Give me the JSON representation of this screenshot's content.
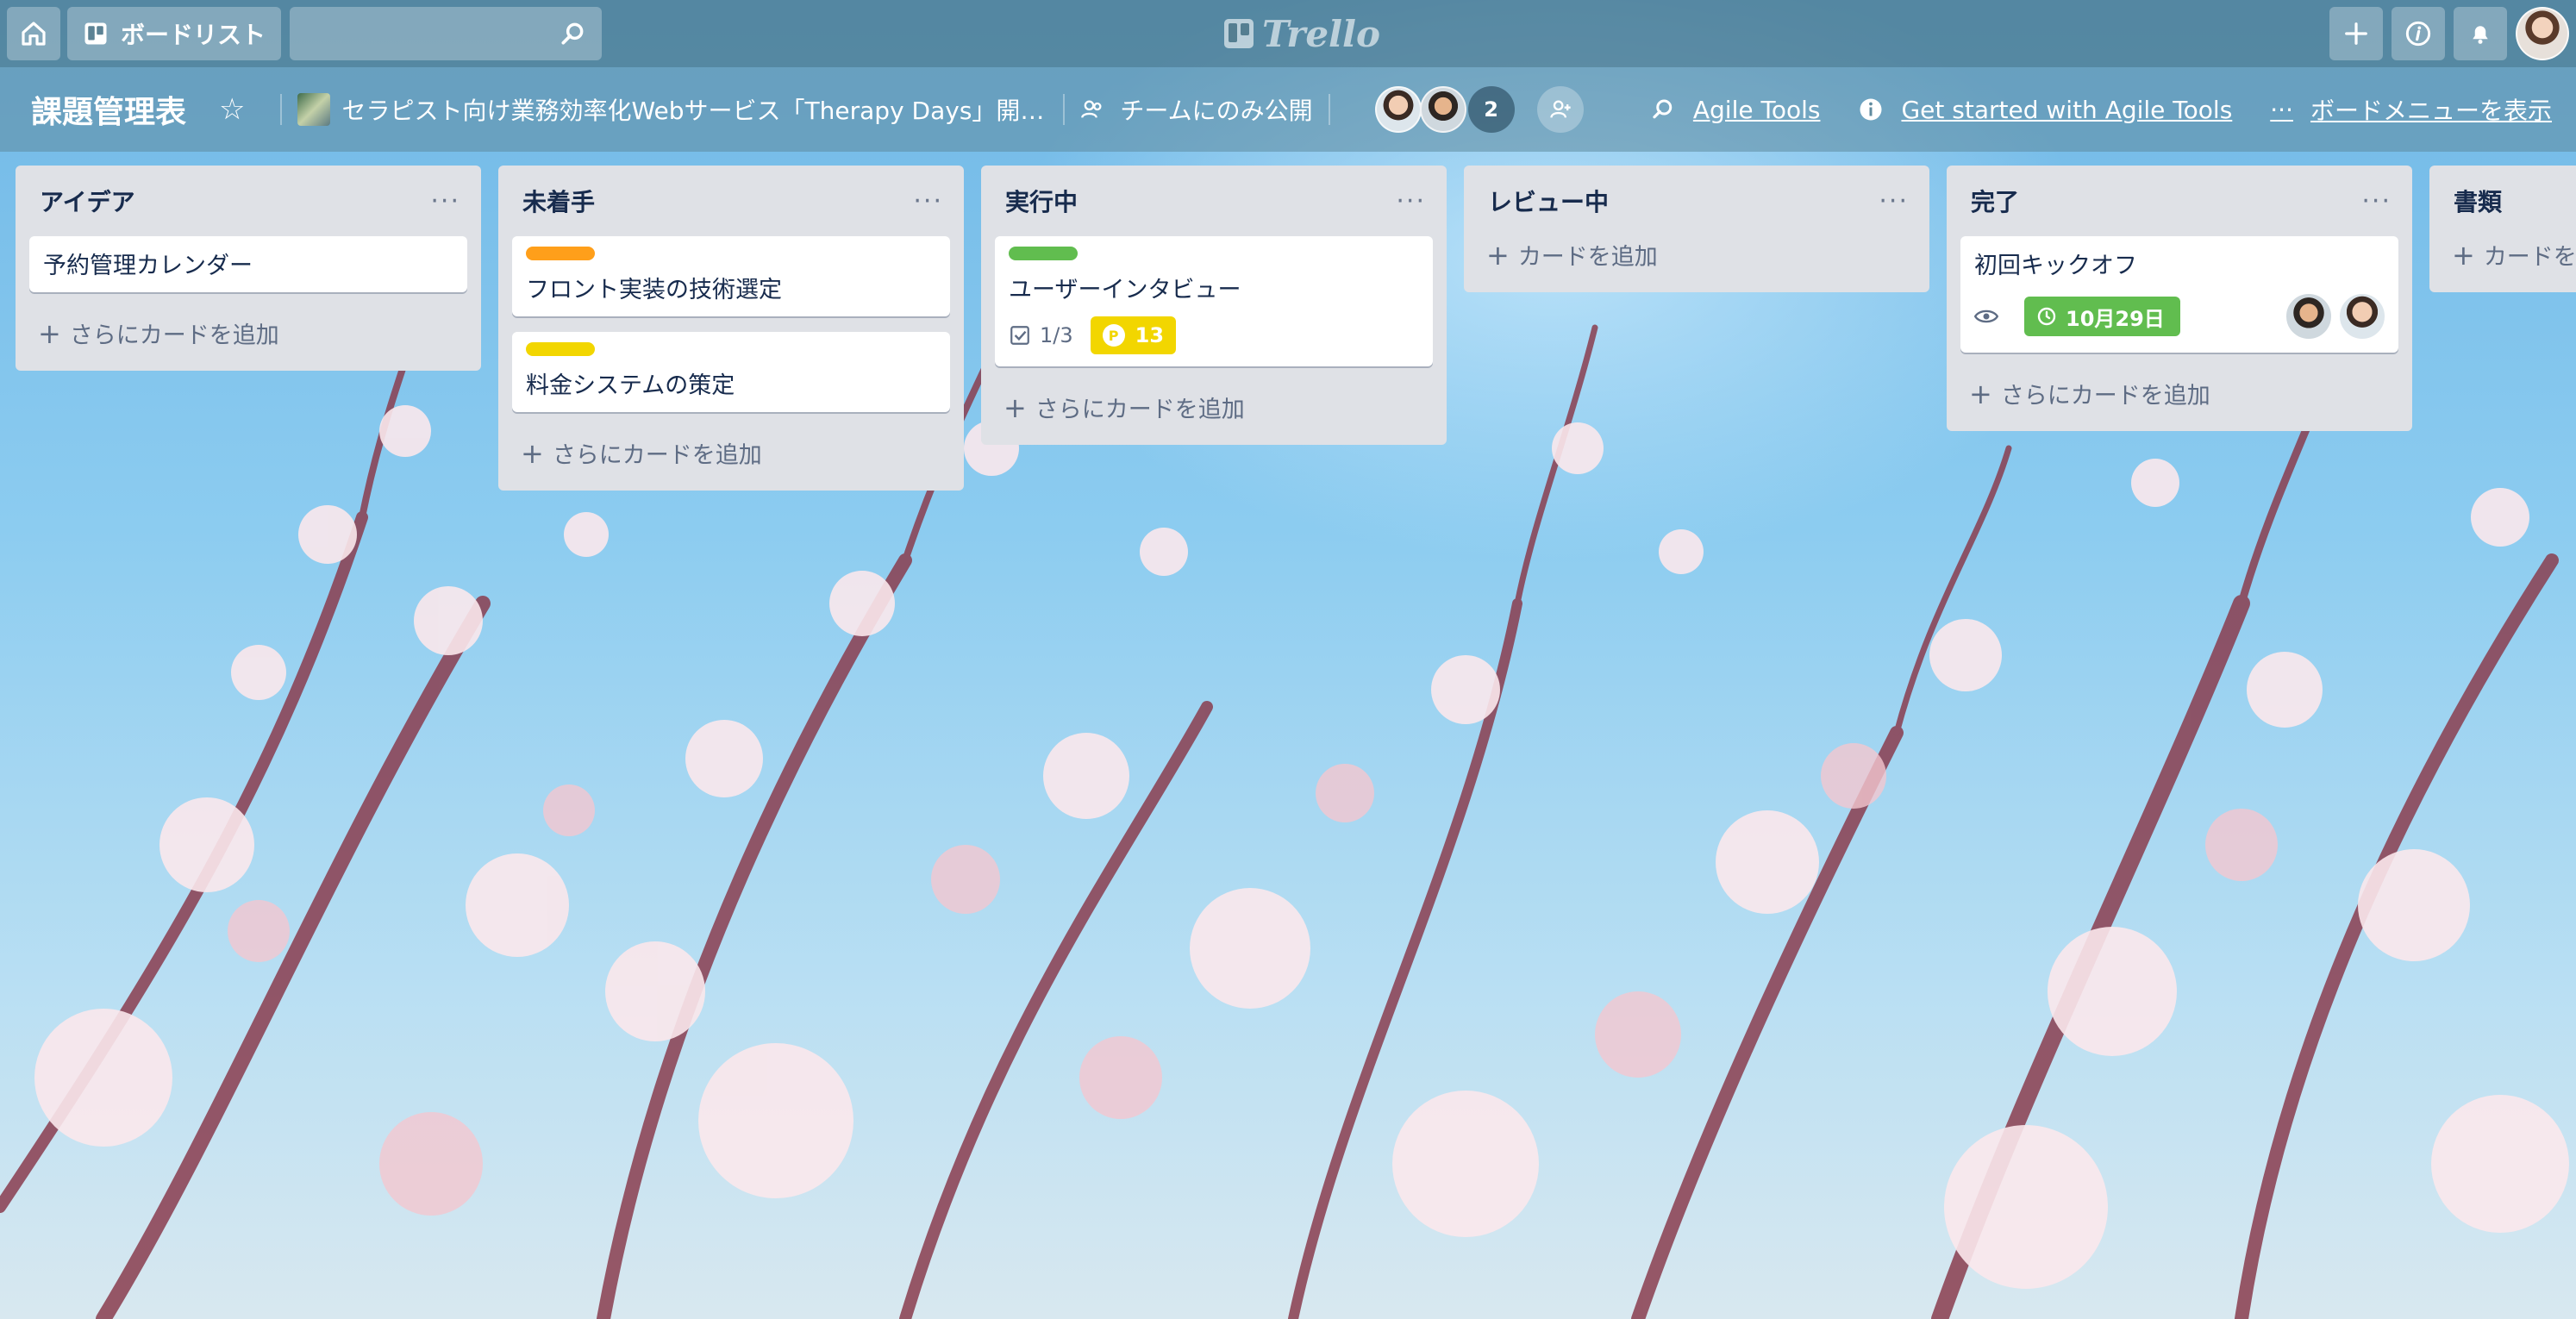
{
  "topbar": {
    "home_icon": "home-icon",
    "boards_label": "ボードリスト",
    "search_placeholder": "",
    "logo_text": "Trello",
    "add_icon": "plus-icon",
    "info_icon": "info-icon",
    "notification_icon": "bell-icon"
  },
  "board": {
    "title": "課題管理表",
    "team": "セラピスト向け業務効率化Webサービス「Therapy Days」開…",
    "visibility": "チームにのみ公開",
    "member_count": "2",
    "agile_tools": "Agile Tools",
    "get_started": "Get started with Agile Tools",
    "menu": "ボードメニューを表示"
  },
  "lists": [
    {
      "title": "アイデア",
      "cards": [
        {
          "title": "予約管理カレンダー"
        }
      ],
      "add_label": "さらにカードを追加"
    },
    {
      "title": "未着手",
      "cards": [
        {
          "title": "フロント実装の技術選定",
          "label_color": "#ff9f1a"
        },
        {
          "title": "料金システムの策定",
          "label_color": "#f2d600"
        }
      ],
      "add_label": "さらにカードを追加"
    },
    {
      "title": "実行中",
      "cards": [
        {
          "title": "ユーザーインタビュー",
          "label_color": "#61bd4f",
          "checklist": "1/3",
          "points_icon": "P",
          "points": "13"
        }
      ],
      "add_label": "さらにカードを追加"
    },
    {
      "title": "レビュー中",
      "cards": [],
      "add_label": "カードを追加"
    },
    {
      "title": "完了",
      "cards": [
        {
          "title": "初回キックオフ",
          "due": "10月29日"
        }
      ],
      "add_label": "さらにカードを追加"
    },
    {
      "title": "書類",
      "cards": [],
      "add_label": "カードを追加"
    }
  ],
  "colors": {
    "label_orange": "#ff9f1a",
    "label_yellow": "#f2d600",
    "label_green": "#61bd4f",
    "list_bg": "#dfe1e6"
  }
}
